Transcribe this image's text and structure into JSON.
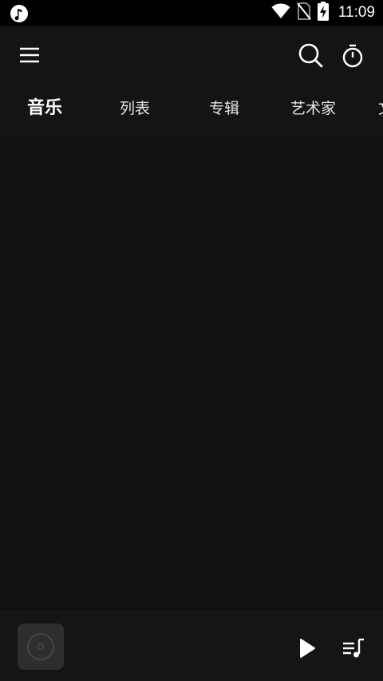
{
  "status_bar": {
    "time": "11:09",
    "icons": [
      "music-note-icon",
      "wifi-icon",
      "no-sim-icon",
      "battery-charging-icon"
    ]
  },
  "toolbar": {
    "icons": [
      "menu-icon",
      "search-icon",
      "timer-icon"
    ]
  },
  "tabs": [
    {
      "label": "音乐",
      "active": true
    },
    {
      "label": "列表",
      "active": false
    },
    {
      "label": "专辑",
      "active": false
    },
    {
      "label": "艺术家",
      "active": false
    },
    {
      "label": "文",
      "active": false
    }
  ],
  "player": {
    "icons": [
      "album-art-icon",
      "play-icon",
      "queue-icon"
    ]
  },
  "colors": {
    "background": "#121212",
    "status_bar": "#000000",
    "text": "#ffffff",
    "album_tile": "#2e2e2e"
  }
}
